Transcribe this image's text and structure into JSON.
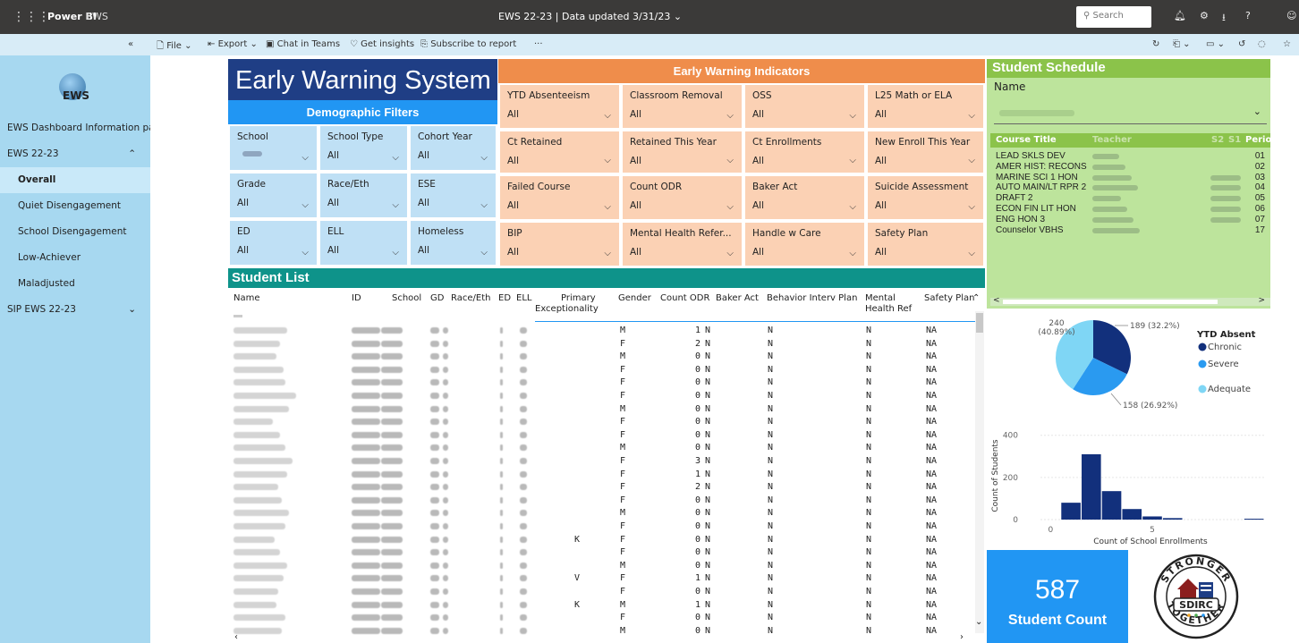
{
  "topbar": {
    "brand": "Power BI",
    "workspace": "EWS",
    "report_title": "EWS 22-23  |  Data updated 3/31/23",
    "search_placeholder": "Search"
  },
  "actionbar": {
    "file": "File",
    "export": "Export",
    "chat": "Chat in Teams",
    "insights": "Get insights",
    "subscribe": "Subscribe to report",
    "more": "···"
  },
  "nav": {
    "app_name": "EWS",
    "items": [
      {
        "label": "EWS Dashboard Information pa..."
      },
      {
        "label": "EWS 22-23"
      },
      {
        "label": "Overall"
      },
      {
        "label": "Quiet Disengagement"
      },
      {
        "label": "School Disengagement"
      },
      {
        "label": "Low-Achiever"
      },
      {
        "label": "Maladjusted"
      },
      {
        "label": "SIP EWS 22-23"
      }
    ]
  },
  "ews_title": "Early Warning System",
  "demographic_header": "Demographic Filters",
  "demographic_filters": [
    {
      "label": "School",
      "value": ""
    },
    {
      "label": "School Type",
      "value": "All"
    },
    {
      "label": "Cohort Year",
      "value": "All"
    },
    {
      "label": "Grade",
      "value": "All"
    },
    {
      "label": "Race/Eth",
      "value": "All"
    },
    {
      "label": "ESE",
      "value": "All"
    },
    {
      "label": "ED",
      "value": "All"
    },
    {
      "label": "ELL",
      "value": "All"
    },
    {
      "label": "Homeless",
      "value": "All"
    }
  ],
  "indicator_header": "Early Warning Indicators",
  "indicator_filters": [
    {
      "label": "YTD Absenteeism",
      "value": "All"
    },
    {
      "label": "Classroom Removal",
      "value": "All"
    },
    {
      "label": "OSS",
      "value": "All"
    },
    {
      "label": "L25 Math or ELA",
      "value": "All"
    },
    {
      "label": "Ct Retained",
      "value": "All"
    },
    {
      "label": "Retained This Year",
      "value": "All"
    },
    {
      "label": "Ct Enrollments",
      "value": "All"
    },
    {
      "label": "New Enroll This Year",
      "value": "All"
    },
    {
      "label": "Failed Course",
      "value": "All"
    },
    {
      "label": "Count ODR",
      "value": "All"
    },
    {
      "label": "Baker Act",
      "value": "All"
    },
    {
      "label": "Suicide Assessment",
      "value": "All"
    },
    {
      "label": "BIP",
      "value": "All"
    },
    {
      "label": "Mental Health Refer...",
      "value": "All"
    },
    {
      "label": "Handle w Care",
      "value": "All"
    },
    {
      "label": "Safety Plan",
      "value": "All"
    }
  ],
  "student_list": {
    "title": "Student List",
    "columns": {
      "name": "Name",
      "id": "ID",
      "school": "School",
      "gd": "GD",
      "race": "Race/Eth",
      "ed": "ED",
      "ell": "ELL",
      "pe1": "Primary",
      "pe2": "Exceptionality",
      "gender": "Gender",
      "odr": "Count ODR",
      "baker": "Baker Act",
      "bip": "Behavior Interv Plan",
      "mh1": "Mental",
      "mh2": "Health Ref",
      "safety": "Safety Plan"
    },
    "rows": [
      {
        "pe": "",
        "gender": "M",
        "odr": "1",
        "baker": "N",
        "bip": "N",
        "mh": "N",
        "safety": "NA"
      },
      {
        "pe": "",
        "gender": "F",
        "odr": "2",
        "baker": "N",
        "bip": "N",
        "mh": "N",
        "safety": "NA"
      },
      {
        "pe": "",
        "gender": "M",
        "odr": "0",
        "baker": "N",
        "bip": "N",
        "mh": "N",
        "safety": "NA"
      },
      {
        "pe": "",
        "gender": "F",
        "odr": "0",
        "baker": "N",
        "bip": "N",
        "mh": "N",
        "safety": "NA"
      },
      {
        "pe": "",
        "gender": "F",
        "odr": "0",
        "baker": "N",
        "bip": "N",
        "mh": "N",
        "safety": "NA"
      },
      {
        "pe": "",
        "gender": "F",
        "odr": "0",
        "baker": "N",
        "bip": "N",
        "mh": "N",
        "safety": "NA"
      },
      {
        "pe": "",
        "gender": "M",
        "odr": "0",
        "baker": "N",
        "bip": "N",
        "mh": "N",
        "safety": "NA"
      },
      {
        "pe": "",
        "gender": "F",
        "odr": "0",
        "baker": "N",
        "bip": "N",
        "mh": "N",
        "safety": "NA"
      },
      {
        "pe": "",
        "gender": "F",
        "odr": "0",
        "baker": "N",
        "bip": "N",
        "mh": "N",
        "safety": "NA"
      },
      {
        "pe": "",
        "gender": "M",
        "odr": "0",
        "baker": "N",
        "bip": "N",
        "mh": "N",
        "safety": "NA"
      },
      {
        "pe": "",
        "gender": "F",
        "odr": "3",
        "baker": "N",
        "bip": "N",
        "mh": "N",
        "safety": "NA"
      },
      {
        "pe": "",
        "gender": "F",
        "odr": "1",
        "baker": "N",
        "bip": "N",
        "mh": "N",
        "safety": "NA"
      },
      {
        "pe": "",
        "gender": "F",
        "odr": "2",
        "baker": "N",
        "bip": "N",
        "mh": "N",
        "safety": "NA"
      },
      {
        "pe": "",
        "gender": "F",
        "odr": "0",
        "baker": "N",
        "bip": "N",
        "mh": "N",
        "safety": "NA"
      },
      {
        "pe": "",
        "gender": "M",
        "odr": "0",
        "baker": "N",
        "bip": "N",
        "mh": "N",
        "safety": "NA"
      },
      {
        "pe": "",
        "gender": "F",
        "odr": "0",
        "baker": "N",
        "bip": "N",
        "mh": "N",
        "safety": "NA"
      },
      {
        "pe": "K",
        "gender": "F",
        "odr": "0",
        "baker": "N",
        "bip": "N",
        "mh": "N",
        "safety": "NA"
      },
      {
        "pe": "",
        "gender": "F",
        "odr": "0",
        "baker": "N",
        "bip": "N",
        "mh": "N",
        "safety": "NA"
      },
      {
        "pe": "",
        "gender": "M",
        "odr": "0",
        "baker": "N",
        "bip": "N",
        "mh": "N",
        "safety": "NA"
      },
      {
        "pe": "V",
        "gender": "F",
        "odr": "1",
        "baker": "N",
        "bip": "N",
        "mh": "N",
        "safety": "NA"
      },
      {
        "pe": "",
        "gender": "F",
        "odr": "0",
        "baker": "N",
        "bip": "N",
        "mh": "N",
        "safety": "NA"
      },
      {
        "pe": "K",
        "gender": "M",
        "odr": "1",
        "baker": "N",
        "bip": "N",
        "mh": "N",
        "safety": "NA"
      },
      {
        "pe": "",
        "gender": "F",
        "odr": "0",
        "baker": "N",
        "bip": "N",
        "mh": "N",
        "safety": "NA"
      },
      {
        "pe": "",
        "gender": "M",
        "odr": "0",
        "baker": "N",
        "bip": "N",
        "mh": "N",
        "safety": "NA"
      }
    ]
  },
  "schedule": {
    "title": "Student Schedule",
    "name_label": "Name",
    "col_course": "Course Title",
    "col_teacher": "Teacher",
    "col_s2": "S2",
    "col_s1": "S1",
    "col_period": "Period",
    "rows": [
      {
        "course": "LEAD SKLS DEV",
        "period": "01"
      },
      {
        "course": "AMER HIST: RECONS",
        "period": "02"
      },
      {
        "course": "MARINE SCI 1 HON",
        "period": "03"
      },
      {
        "course": "AUTO MAIN/LT RPR 2",
        "period": "04"
      },
      {
        "course": "DRAFT 2",
        "period": "05"
      },
      {
        "course": "ECON FIN LIT HON",
        "period": "06"
      },
      {
        "course": "ENG HON 3",
        "period": "07"
      },
      {
        "course": "Counselor VBHS",
        "period": "17"
      }
    ]
  },
  "pie": {
    "legend_title": "YTD Absent",
    "slices": [
      {
        "name": "Chronic",
        "value": 189,
        "label": "189 (32.2%)",
        "color": "#12307c"
      },
      {
        "name": "Severe",
        "value": 158,
        "label": "158 (26.92%)",
        "color": "#2a9af0"
      },
      {
        "name": "Adequate",
        "value": 240,
        "label": "240 (40.89%)",
        "color": "#7fd6f5"
      }
    ]
  },
  "chart_data": {
    "type": "bar",
    "xlabel": "Count of School Enrollments",
    "ylabel": "Count of Students",
    "y_ticks": [
      "400",
      "200",
      "0"
    ],
    "x_ticks": [
      "0",
      "5"
    ],
    "ylim": [
      0,
      420
    ],
    "xlim": [
      -0.5,
      10.5
    ],
    "x": [
      1,
      2,
      3,
      4,
      5,
      6,
      10
    ],
    "values": [
      80,
      310,
      135,
      50,
      15,
      7,
      4
    ],
    "color": "#12307c"
  },
  "kpi": {
    "value": "587",
    "label": "Student Count"
  },
  "logo": {
    "top": "STRONGER",
    "middle": "SDIRC",
    "bottom": "TOGETHER"
  }
}
